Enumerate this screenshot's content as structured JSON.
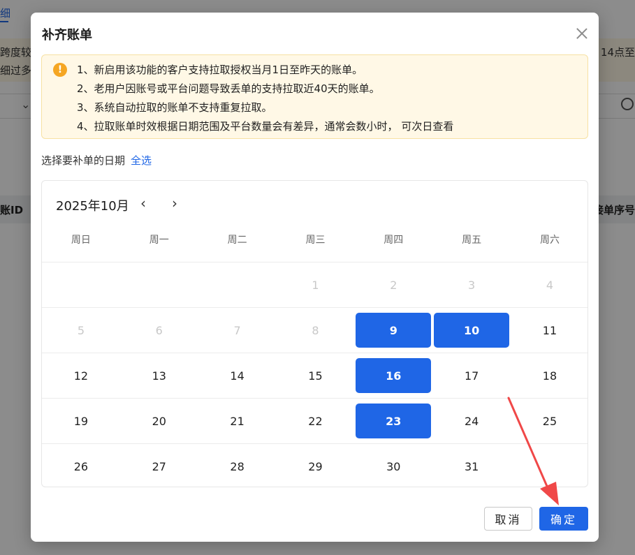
{
  "background": {
    "tab_label": "细",
    "notice_left_line1": "跨度较",
    "notice_left_line2": "细过多",
    "notice_right": "14点至",
    "col_left": "账ID",
    "col_right": "接单序号"
  },
  "dialog": {
    "title": "补齐账单",
    "alert_items": [
      "1、新启用该功能的客户支持拉取授权当月1日至昨天的账单。",
      "2、老用户因账号或平台问题导致丢单的支持拉取近40天的账单。",
      "3、系统自动拉取的账单不支持重复拉取。",
      "4、拉取账单时效根据日期范围及平台数量会有差异，通常会数小时， 可次日查看"
    ],
    "select_label": "选择要补单的日期",
    "select_all": "全选",
    "calendar": {
      "month_label": "2025年10月",
      "weekdays": [
        "周日",
        "周一",
        "周二",
        "周三",
        "周四",
        "周五",
        "周六"
      ],
      "weeks": [
        [
          "",
          "",
          "",
          "1",
          "2",
          "3",
          "4"
        ],
        [
          "5",
          "6",
          "7",
          "8",
          "9",
          "10",
          "11"
        ],
        [
          "12",
          "13",
          "14",
          "15",
          "16",
          "17",
          "18"
        ],
        [
          "19",
          "20",
          "21",
          "22",
          "23",
          "24",
          "25"
        ],
        [
          "26",
          "27",
          "28",
          "29",
          "30",
          "31",
          ""
        ]
      ],
      "disabled_days": [
        "1",
        "2",
        "3",
        "4",
        "5",
        "6",
        "7",
        "8"
      ],
      "selected_days": [
        "9",
        "10",
        "16",
        "23"
      ]
    },
    "cancel_label": "取消",
    "ok_label": "确定"
  },
  "colors": {
    "accent": "#1f66e6",
    "warning": "#f5a623",
    "annotation_arrow": "#f04848"
  }
}
